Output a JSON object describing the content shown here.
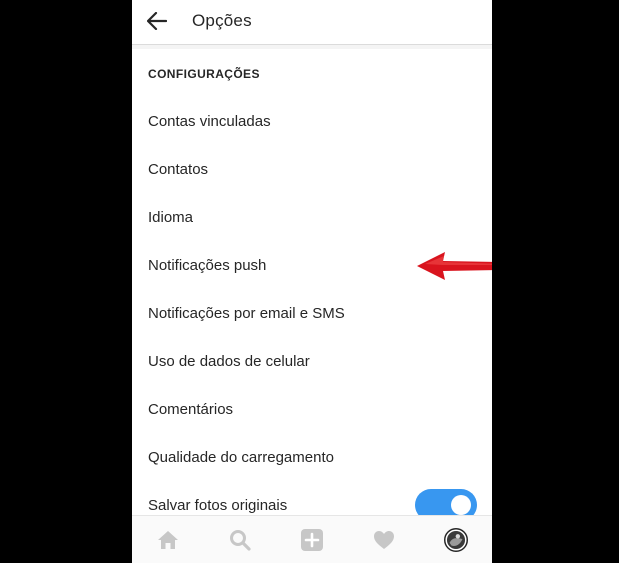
{
  "header": {
    "title": "Opções",
    "back_icon": "arrow-left-icon"
  },
  "settings": {
    "section_title": "CONFIGURAÇÕES",
    "items": [
      {
        "label": "Contas vinculadas"
      },
      {
        "label": "Contatos"
      },
      {
        "label": "Idioma"
      },
      {
        "label": "Notificações push"
      },
      {
        "label": "Notificações por email e SMS"
      },
      {
        "label": "Uso de dados de celular"
      },
      {
        "label": "Comentários"
      },
      {
        "label": "Qualidade do carregamento"
      },
      {
        "label": "Salvar fotos originais",
        "toggle": true
      }
    ]
  },
  "bottom_nav": {
    "icons": [
      "home-icon",
      "search-icon",
      "add-post-icon",
      "heart-icon",
      "profile-avatar-icon"
    ]
  },
  "colors": {
    "accent": "#3897f0",
    "annotation_arrow": "#d9141e",
    "text": "#262626",
    "nav_icon": "#c7c7c7"
  }
}
